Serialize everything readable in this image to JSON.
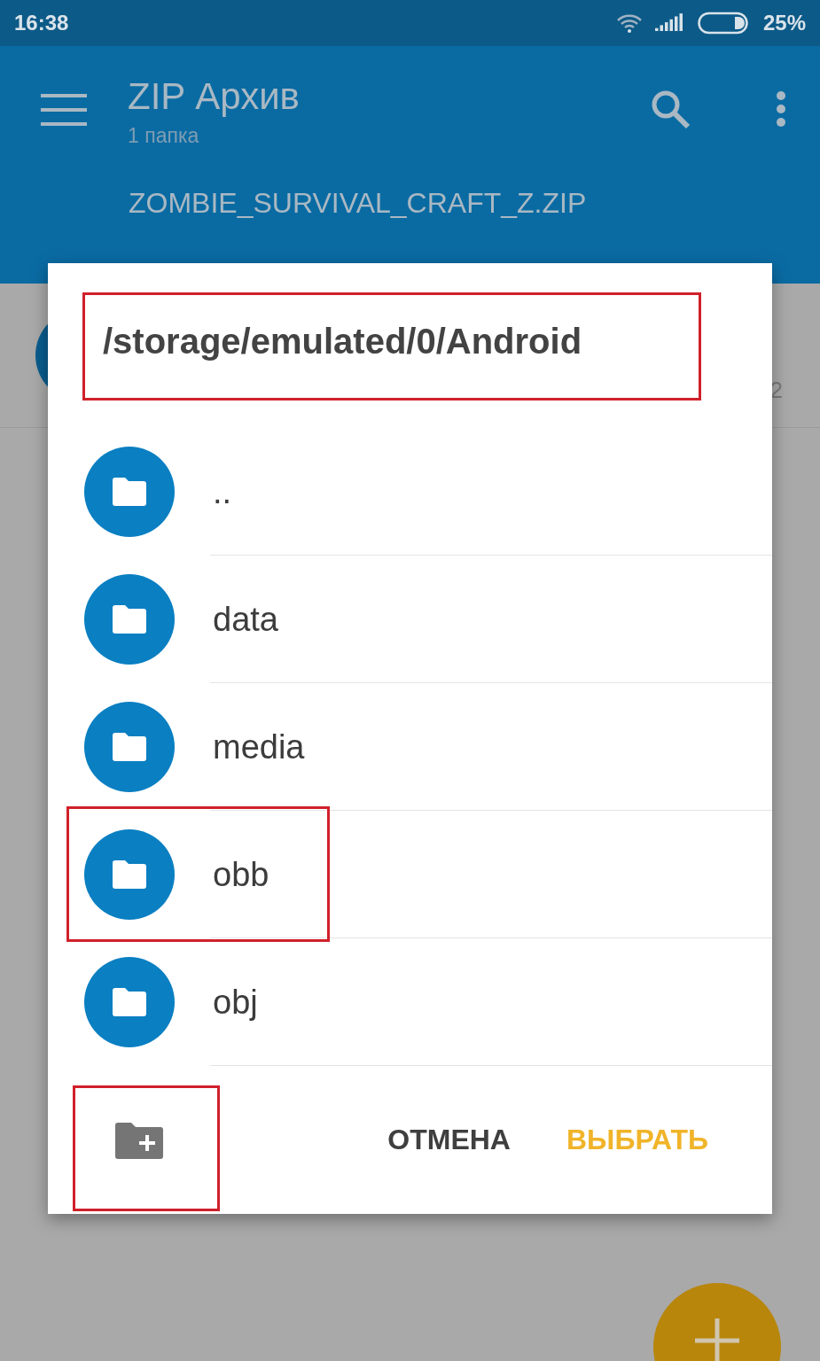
{
  "status_bar": {
    "time": "16:38",
    "battery": "25%"
  },
  "app_bar": {
    "title": "ZIP Архив",
    "subtitle": "1 папка",
    "tab": "ZOMBIE_SURVIVAL_CRAFT_Z.ZIP"
  },
  "background_row": {
    "column_2": "2"
  },
  "dialog": {
    "path": {
      "text": "/storage/emulated/0/Android",
      "highlighted": true
    },
    "items": [
      {
        "name": "..",
        "highlighted": false
      },
      {
        "name": "data",
        "highlighted": false
      },
      {
        "name": "media",
        "highlighted": false
      },
      {
        "name": "obb",
        "highlighted": true
      },
      {
        "name": "obj",
        "highlighted": false
      }
    ],
    "new_folder": {
      "highlighted": true
    },
    "buttons": [
      {
        "label": "ОТМЕНА",
        "kind": "secondary"
      },
      {
        "label": "ВЫБРАТЬ",
        "kind": "primary"
      }
    ]
  }
}
